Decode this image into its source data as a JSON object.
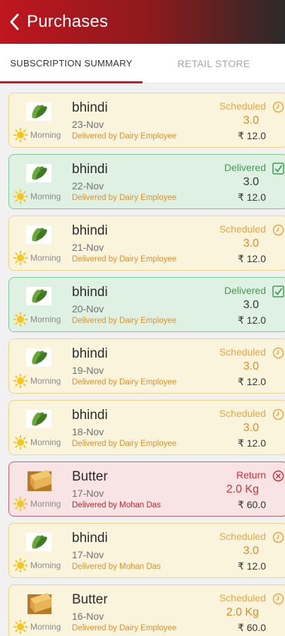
{
  "header": {
    "title": "Purchases"
  },
  "tabs": [
    {
      "label": "SUBSCRIPTION SUMMARY",
      "active": true
    },
    {
      "label": "RETAIL STORE",
      "active": false
    }
  ],
  "colors": {
    "brand_red": "#c0161f",
    "scheduled": "#e8a547",
    "delivered": "#3f9a4e",
    "return": "#c9323a"
  },
  "orders": [
    {
      "name": "bhindi",
      "date": "23-Nov",
      "time": "Morning",
      "delivered_by": "Delivered by Dairy Employee",
      "status": "Scheduled",
      "quantity": "3.0",
      "price": "₹ 12.0",
      "icon": "okra-icon",
      "status_icon": "clock-icon"
    },
    {
      "name": "bhindi",
      "date": "22-Nov",
      "time": "Morning",
      "delivered_by": "Delivered by Dairy Employee",
      "status": "Delivered",
      "quantity": "3.0",
      "price": "₹ 12.0",
      "icon": "okra-icon",
      "status_icon": "checkbox-icon"
    },
    {
      "name": "bhindi",
      "date": "21-Nov",
      "time": "Morning",
      "delivered_by": "Delivered by Dairy Employee",
      "status": "Scheduled",
      "quantity": "3.0",
      "price": "₹ 12.0",
      "icon": "okra-icon",
      "status_icon": "clock-icon"
    },
    {
      "name": "bhindi",
      "date": "20-Nov",
      "time": "Morning",
      "delivered_by": "Delivered by Dairy Employee",
      "status": "Delivered",
      "quantity": "3.0",
      "price": "₹ 12.0",
      "icon": "okra-icon",
      "status_icon": "checkbox-icon"
    },
    {
      "name": "bhindi",
      "date": "19-Nov",
      "time": "Morning",
      "delivered_by": "Delivered by Dairy Employee",
      "status": "Scheduled",
      "quantity": "3.0",
      "price": "₹ 12.0",
      "icon": "okra-icon",
      "status_icon": "clock-icon"
    },
    {
      "name": "bhindi",
      "date": "18-Nov",
      "time": "Morning",
      "delivered_by": "Delivered by Dairy Employee",
      "status": "Scheduled",
      "quantity": "3.0",
      "price": "₹ 12.0",
      "icon": "okra-icon",
      "status_icon": "clock-icon"
    },
    {
      "name": "Butter",
      "date": "17-Nov",
      "time": "Morning",
      "delivered_by": "Delivered by Mohan Das",
      "status": "Return",
      "quantity": "2.0 Kg",
      "price": "₹ 60.0",
      "icon": "butter-icon",
      "status_icon": "cancel-icon"
    },
    {
      "name": "bhindi",
      "date": "17-Nov",
      "time": "Morning",
      "delivered_by": "Delivered by Mohan Das",
      "status": "Scheduled",
      "quantity": "3.0",
      "price": "₹ 12.0",
      "icon": "okra-icon",
      "status_icon": "clock-icon"
    },
    {
      "name": "Butter",
      "date": "16-Nov",
      "time": "Morning",
      "delivered_by": "Delivered by Dairy Employee",
      "status": "Scheduled",
      "quantity": "2.0 Kg",
      "price": "₹ 60.0",
      "icon": "butter-icon",
      "status_icon": "clock-icon"
    }
  ]
}
